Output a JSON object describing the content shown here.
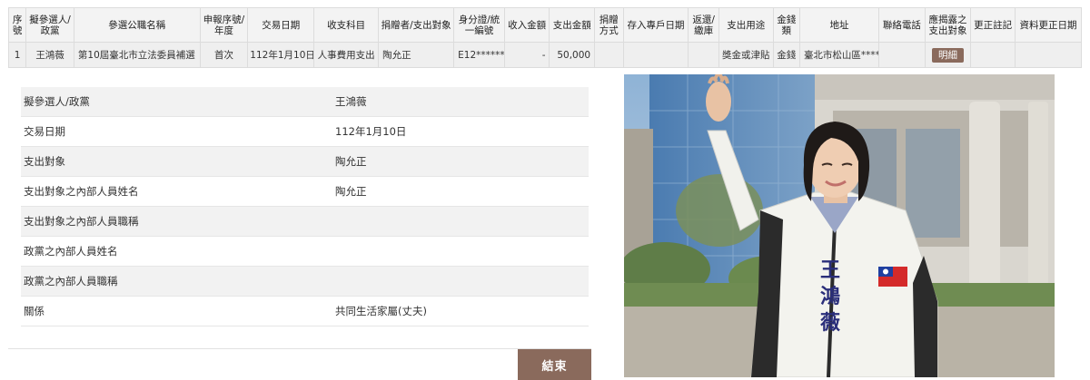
{
  "table": {
    "headers": [
      "序號",
      "擬參選人/政黨",
      "參選公職名稱",
      "申報序號/年度",
      "交易日期",
      "收支科目",
      "捐贈者/支出對象",
      "身分證/統一編號",
      "收入金額",
      "支出金額",
      "捐贈方式",
      "存入專戶日期",
      "返還/繳庫",
      "支出用途",
      "金錢類",
      "地址",
      "聯絡電話",
      "應揭露之支出對象",
      "更正註記",
      "資料更正日期"
    ],
    "row": {
      "seq": "1",
      "candidate": "王鴻薇",
      "office": "第10屆臺北市立法委員補選",
      "report_no": "首次",
      "date": "112年1月10日",
      "subject": "人事費用支出",
      "payee": "陶允正",
      "id_no": "E12*******",
      "income": "-",
      "expense": "50,000",
      "donate_method": "",
      "deposit_date": "",
      "returned": "",
      "usage": "獎金或津貼",
      "money_type": "金錢",
      "address": "臺北市松山區****",
      "phone": "",
      "detail_button": "明細",
      "correction": "",
      "correction_date": ""
    }
  },
  "detail": {
    "rows": [
      {
        "label": "擬參選人/政黨",
        "value": "王鴻薇"
      },
      {
        "label": "交易日期",
        "value": "112年1月10日"
      },
      {
        "label": "支出對象",
        "value": "陶允正"
      },
      {
        "label": "支出對象之內部人員姓名",
        "value": "陶允正"
      },
      {
        "label": "支出對象之內部人員職稱",
        "value": ""
      },
      {
        "label": "政黨之內部人員姓名",
        "value": ""
      },
      {
        "label": "政黨之內部人員職稱",
        "value": ""
      },
      {
        "label": "關係",
        "value": "共同生活家屬(丈夫)"
      }
    ],
    "close_button": "結束"
  },
  "photo": {
    "jacket_name": [
      "王",
      "鴻",
      "薇"
    ]
  },
  "colors": {
    "accent": "#8a6a5c",
    "header_bg": "#f3f3f3",
    "row_bg": "#efefef"
  }
}
